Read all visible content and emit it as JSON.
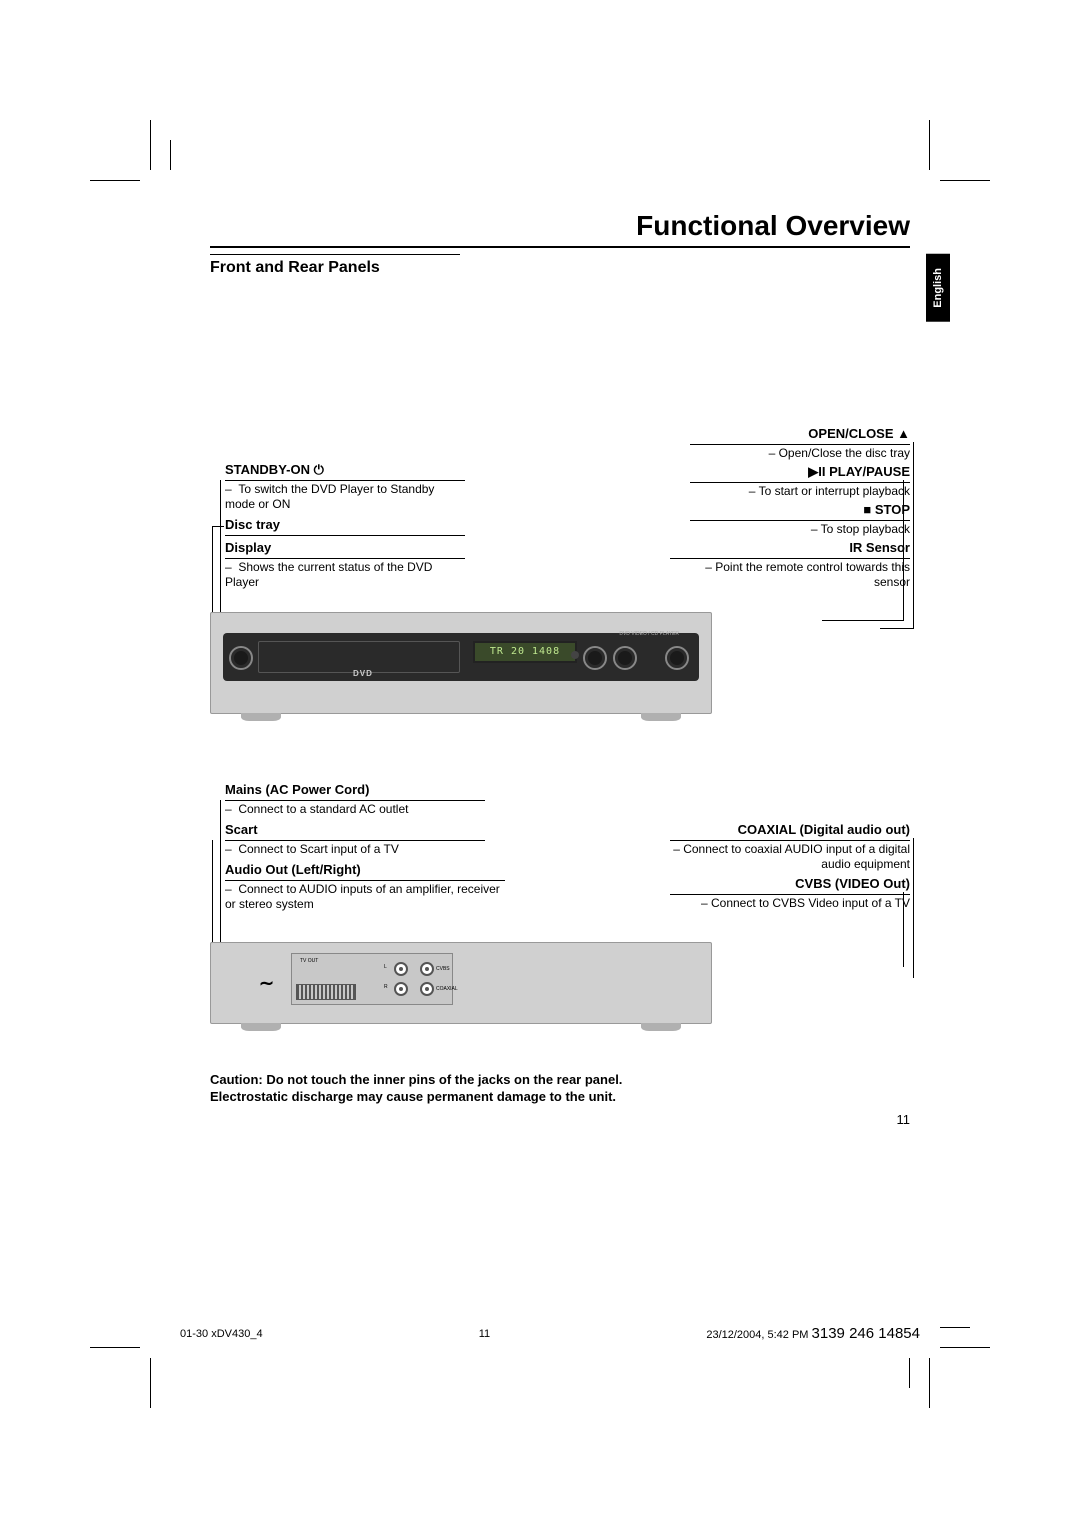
{
  "title": "Functional Overview",
  "section_heading": "Front and Rear Panels",
  "language_tab": "English",
  "front": {
    "standby": {
      "heading": "STANDBY-ON",
      "icon_name": "power-icon",
      "desc": "To switch the DVD Player to Standby mode or ON"
    },
    "disctray": {
      "heading": "Disc tray"
    },
    "display": {
      "heading": "Display",
      "desc": "Shows the current status of the DVD Player"
    },
    "openclose": {
      "heading": "OPEN/CLOSE ▲",
      "desc": "Open/Close the disc tray"
    },
    "playpause": {
      "heading": "▶II PLAY/PAUSE",
      "desc": "To start or interrupt playback"
    },
    "stop": {
      "heading": "■  STOP",
      "desc": "To stop playback"
    },
    "irsensor": {
      "heading": "IR Sensor",
      "desc": "Point the remote control towards this sensor"
    },
    "display_text": "TR 20 1408",
    "panel_label": "DVD VIDEO / CD PLAYER"
  },
  "rear": {
    "mains": {
      "heading": "Mains (AC Power Cord)",
      "desc": "Connect to a standard AC outlet"
    },
    "scart": {
      "heading": "Scart",
      "desc": "Connect to Scart input of a TV"
    },
    "audioout": {
      "heading": "Audio Out (Left/Right)",
      "desc": "Connect to AUDIO inputs of an amplifier, receiver or stereo system"
    },
    "coax": {
      "heading": "COAXIAL (Digital audio out)",
      "desc": "Connect to coaxial AUDIO input of a digital audio equipment"
    },
    "cvbs": {
      "heading": "CVBS (VIDEO Out)",
      "desc": "Connect to CVBS Video input of a TV"
    },
    "tvout_label": "TV OUT",
    "cvbs_label": "CVBS",
    "coax_label": "COAXIAL",
    "l_label": "L",
    "r_label": "R"
  },
  "caution_line1": "Caution: Do not touch the inner pins of the jacks on the rear panel.",
  "caution_line2": "Electrostatic discharge may cause permanent damage to the unit.",
  "page_number": "11",
  "footer": {
    "docname": "01-30 xDV430_4",
    "center_page": "11",
    "timestamp": "23/12/2004, 5:42 PM",
    "partno": "3139 246 14854"
  }
}
